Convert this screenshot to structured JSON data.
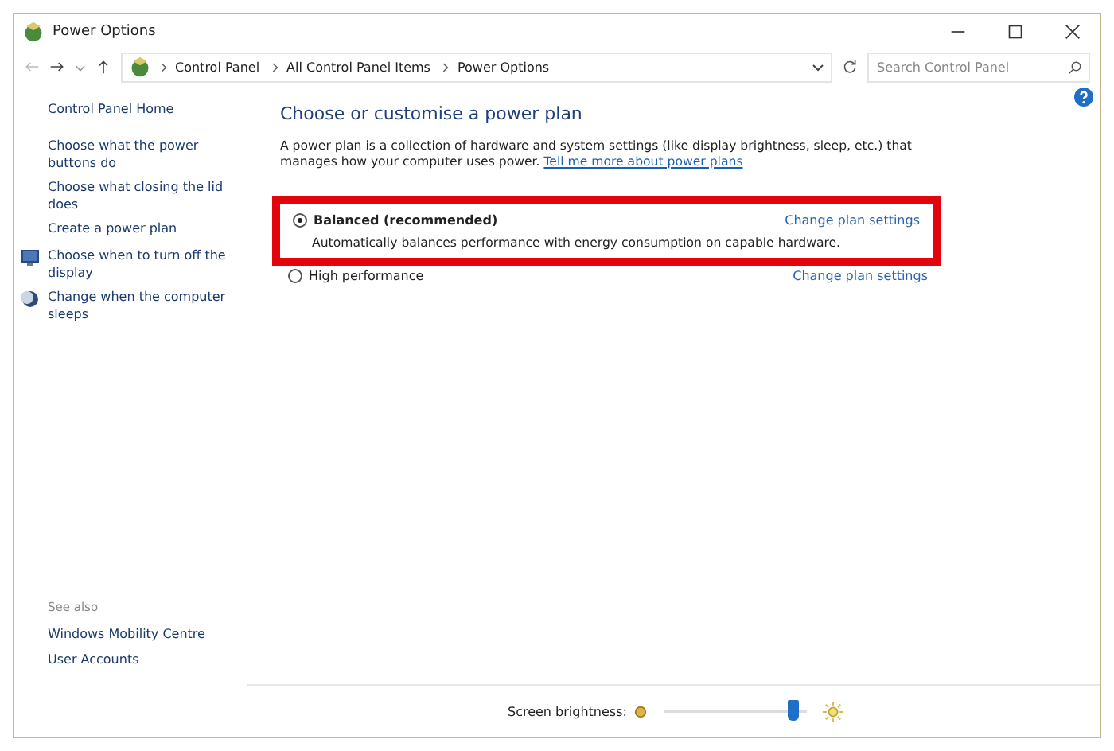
{
  "window": {
    "title": "Power Options"
  },
  "address_bar": {
    "path": [
      "Control Panel",
      "All Control Panel Items",
      "Power Options"
    ]
  },
  "search": {
    "placeholder": "Search Control Panel"
  },
  "sidebar": {
    "home": "Control Panel Home",
    "items": [
      {
        "label": "Choose what the power buttons do"
      },
      {
        "label": "Choose what closing the lid does"
      },
      {
        "label": "Create a power plan"
      },
      {
        "label": "Choose when to turn off the display"
      },
      {
        "label": "Change when the computer sleeps"
      }
    ],
    "see_also": {
      "title": "See also",
      "links": [
        "Windows Mobility Centre",
        "User Accounts"
      ]
    }
  },
  "main": {
    "title": "Choose or customise a power plan",
    "description": "A power plan is a collection of hardware and system settings (like display brightness, sleep, etc.) that manages how your computer uses power.",
    "description_link": "Tell me more about power plans",
    "plans": [
      {
        "name": "Balanced (recommended)",
        "selected": true,
        "highlighted": true,
        "link": "Change plan settings",
        "description": "Automatically balances performance with energy consumption on capable hardware."
      },
      {
        "name": "High performance",
        "selected": false,
        "highlighted": false,
        "link": "Change plan settings"
      }
    ]
  },
  "brightness": {
    "label": "Screen brightness:",
    "level": 0.95
  }
}
